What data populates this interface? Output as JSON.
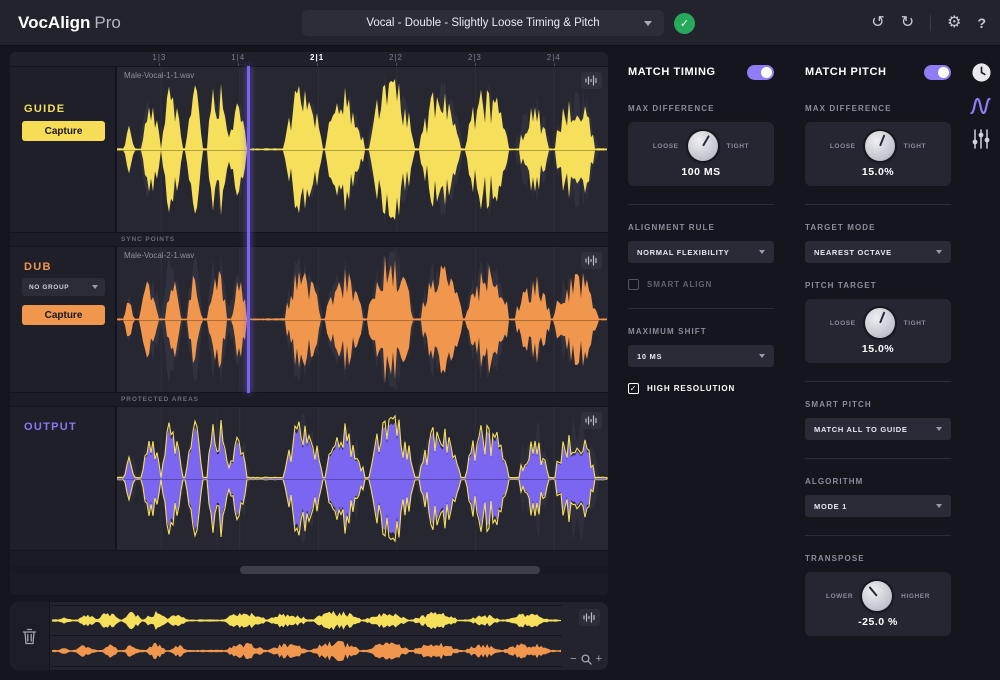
{
  "topbar": {
    "brand": "VocAlign",
    "brand_suffix": "Pro",
    "preset_value": "Vocal - Double - Slightly Loose Timing & Pitch",
    "undo": "↺",
    "redo": "↻",
    "settings": "⚙",
    "help": "?",
    "saved_check": "✓"
  },
  "ruler": {
    "labels": [
      "1|3",
      "1|4",
      "2|1",
      "2|2",
      "2|3",
      "2|4"
    ],
    "positions_pct": [
      9,
      25,
      41,
      57,
      73,
      89
    ],
    "active_label": "2|1"
  },
  "tracks": {
    "playhead_fraction": 0.268,
    "guide": {
      "label": "GUIDE",
      "file": "Male-Vocal-1-1.wav",
      "capture": "Capture"
    },
    "dub": {
      "label": "DUB",
      "group": "NO GROUP",
      "file": "Male-Vocal-2-1.wav",
      "capture": "Capture"
    },
    "output": {
      "label": "OUTPUT"
    },
    "sync_points": "SYNC POINTS",
    "protected_areas": "PROTECTED AREAS"
  },
  "overview": {
    "zoom_out": "−",
    "zoom_in": "+"
  },
  "timing": {
    "title": "MATCH TIMING",
    "enabled": true,
    "max_difference": {
      "label": "MAX DIFFERENCE",
      "left": "LOOSE",
      "right": "TIGHT",
      "value": "100 MS",
      "angle": 30
    },
    "alignment_rule": {
      "label": "ALIGNMENT RULE",
      "value": "NORMAL FLEXIBILITY"
    },
    "smart_align": {
      "label": "SMART ALIGN",
      "checked": false
    },
    "maximum_shift": {
      "label": "MAXIMUM SHIFT",
      "value": "10 MS"
    },
    "high_resolution": {
      "label": "HIGH RESOLUTION",
      "checked": true
    }
  },
  "pitch": {
    "title": "MATCH PITCH",
    "enabled": true,
    "max_difference": {
      "label": "MAX DIFFERENCE",
      "left": "LOOSE",
      "right": "TIGHT",
      "value": "15.0%",
      "angle": 22
    },
    "target_mode": {
      "label": "TARGET MODE",
      "value": "NEAREST OCTAVE"
    },
    "pitch_target": {
      "label": "PITCH TARGET",
      "left": "LOOSE",
      "right": "TIGHT",
      "value": "15.0%",
      "angle": 22
    },
    "smart_pitch": {
      "label": "SMART PITCH",
      "value": "MATCH ALL TO GUIDE"
    },
    "algorithm": {
      "label": "ALGORITHM",
      "value": "MODE 1"
    },
    "transpose": {
      "label": "TRANSPOSE",
      "left": "LOWER",
      "right": "HIGHER",
      "value": "-25.0 %",
      "angle": -40
    }
  },
  "colors": {
    "guide": "#f6df5a",
    "dub": "#f0964d",
    "output": "#7b66f2",
    "ghost": "#3c3c49",
    "accent": "#8f7df5",
    "success": "#27a95c"
  }
}
